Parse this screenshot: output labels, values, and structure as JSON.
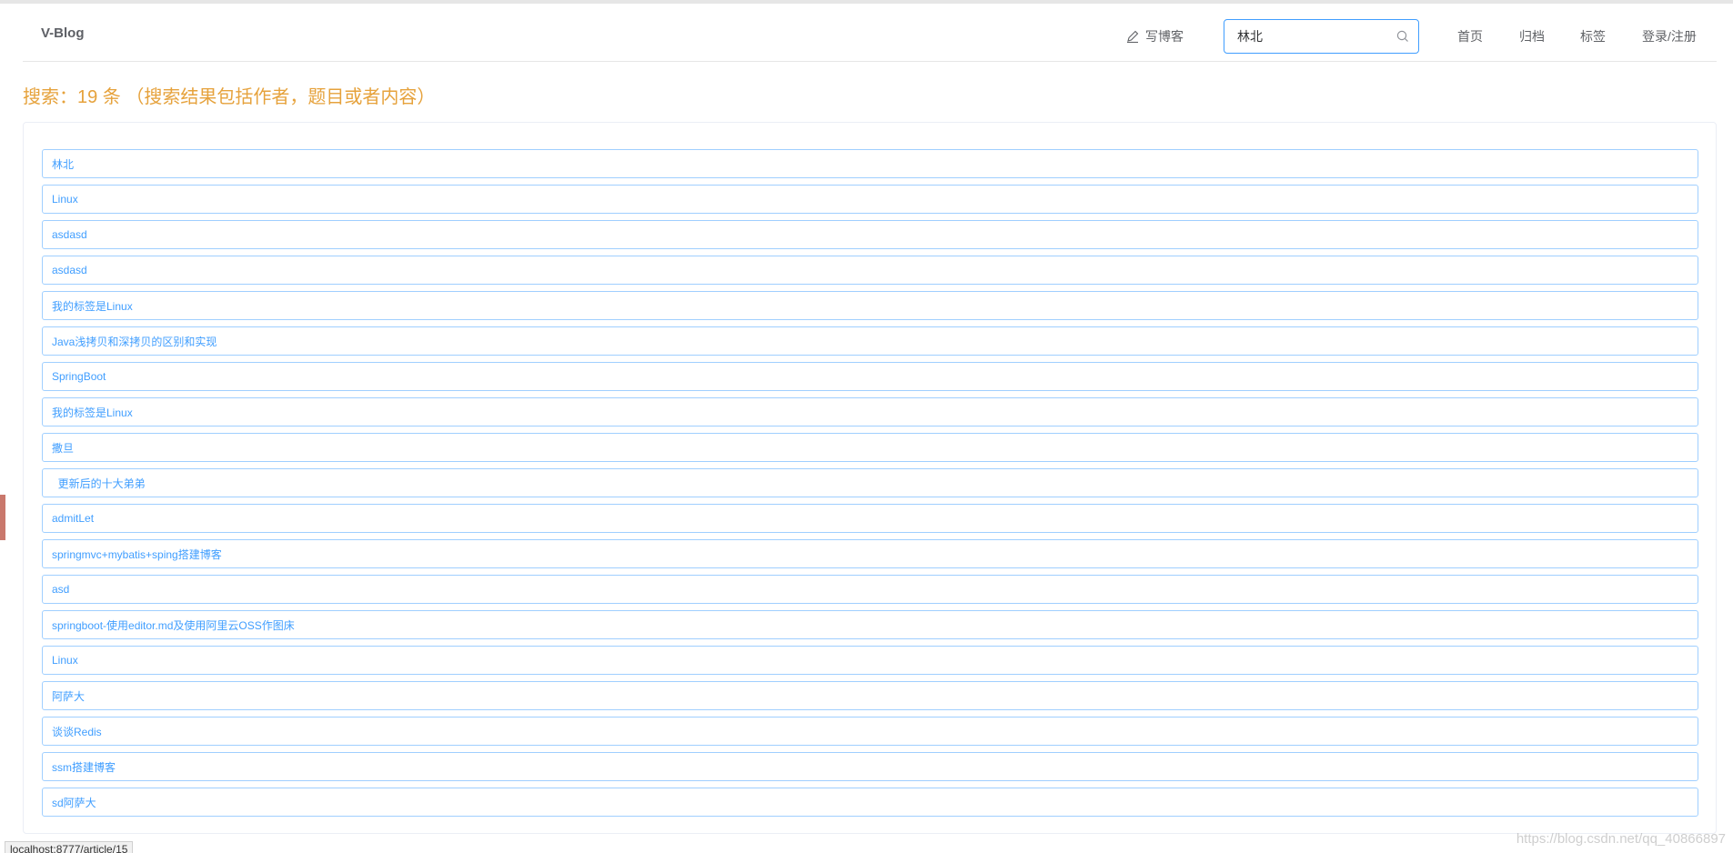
{
  "header": {
    "logo": "V-Blog",
    "write_blog": "写博客",
    "search_value": "林北",
    "nav": {
      "home": "首页",
      "archive": "归档",
      "tags": "标签",
      "login": "登录/注册"
    }
  },
  "search_result": {
    "title": "搜索：19 条  （搜索结果包括作者，题目或者内容）",
    "items": [
      "林北",
      "Linux",
      "asdasd",
      "asdasd",
      "我的标签是Linux",
      "Java浅拷贝和深拷贝的区别和实现",
      "SpringBoot",
      "我的标签是Linux",
      "撒旦",
      "  更新后的十大弟弟",
      "admitLet",
      "springmvc+mybatis+sping搭建博客",
      "asd",
      "springboot-使用editor.md及使用阿里云OSS作图床",
      "Linux",
      "阿萨大",
      "谈谈Redis",
      "ssm搭建博客",
      "sd阿萨大"
    ]
  },
  "status_bar": {
    "url": "localhost:8777/article/15"
  },
  "watermark": "https://blog.csdn.net/qq_40866897",
  "colors": {
    "accent": "#409eff",
    "title": "#e6a23c",
    "item_border": "#a0cfff"
  }
}
